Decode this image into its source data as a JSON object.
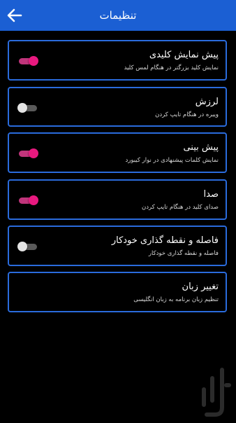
{
  "header": {
    "title": "تنظیمات",
    "back_icon": "arrow-left-icon",
    "color": "#1b5fd3"
  },
  "settings": [
    {
      "label": "پیش نمایش کلیدی",
      "description": "نمایش کلید بزرگتر در هنگام لمس کلید",
      "toggle": "on"
    },
    {
      "label": "لرزش",
      "description": "ویبره در هنگام تایپ کردن",
      "toggle": "off"
    },
    {
      "label": "پیش بینی",
      "description": "نمایش کلمات پیشنهادی در نوار کیبورد",
      "toggle": "on"
    },
    {
      "label": "صدا",
      "description": "صدای کلید در هنگام تایپ کردن",
      "toggle": "on"
    },
    {
      "label": "فاصله و نقطه گذاری خودکار",
      "description": "فاصله و نقطه گذاری خودکار",
      "toggle": "off"
    },
    {
      "label": "تغییر زبان",
      "description": "تنظیم زبان برنامه به زبان انگلیسی"
    }
  ],
  "colors": {
    "accent_border": "#2a6bdc",
    "toggle_on": "#e8197f",
    "toggle_off": "#e4e4e4"
  },
  "watermark": "bazaar-logo-icon"
}
